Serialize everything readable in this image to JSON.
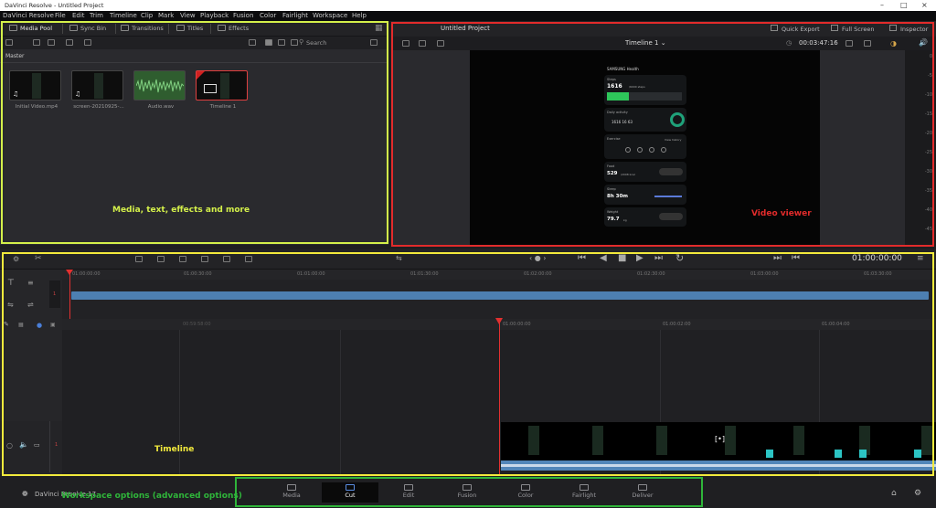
{
  "window": {
    "title": "DaVinci Resolve - Untitled Project"
  },
  "menu": [
    "DaVinci Resolve",
    "File",
    "Edit",
    "Trim",
    "Timeline",
    "Clip",
    "Mark",
    "View",
    "Playback",
    "Fusion",
    "Color",
    "Fairlight",
    "Workspace",
    "Help"
  ],
  "media_pool": {
    "tabs": [
      "Media Pool",
      "Sync Bin",
      "Transitions",
      "Titles",
      "Effects"
    ],
    "search_placeholder": "Search",
    "bin": "Master",
    "clips": [
      "Initial Video.mp4",
      "screen-20210925-...",
      "Audio.wav",
      "Timeline 1"
    ]
  },
  "viewer": {
    "project_title": "Untitled Project",
    "timeline_name": "Timeline 1",
    "timecode": "00:03:47:16",
    "buttons": [
      "Quick Export",
      "Full Screen",
      "Inspector"
    ],
    "meter_scale": [
      "0",
      "-5",
      "-10",
      "-15",
      "-20",
      "-25",
      "-30",
      "-35",
      "-40",
      "-45",
      "-50"
    ]
  },
  "phone": {
    "header": "SAMSUNG Health",
    "cards": [
      {
        "title": "Steps",
        "value": "1616",
        "sub": "/6000 steps"
      },
      {
        "title": "Daily activity",
        "value": "1616  16  63"
      },
      {
        "title": "Exercise",
        "value": "View history"
      },
      {
        "title": "Food",
        "value": "529",
        "sub": "/2008 kcal"
      },
      {
        "title": "Sleep",
        "value": "8h 30m"
      },
      {
        "title": "Weight",
        "value": "79.7",
        "sub": "kg"
      }
    ]
  },
  "timeline": {
    "timecode": "01:00:00:00",
    "ruler_top": [
      "01:00:00:00",
      "01:00:30:00",
      "01:01:00:00",
      "01:01:30:00",
      "01:02:00:00",
      "01:02:30:00",
      "01:03:00:00",
      "01:03:30:00"
    ],
    "ruler_bottom": [
      "00:59:58:00",
      "01:00:00:00",
      "01:00:02:00",
      "01:00:04:00"
    ],
    "track_num": "1"
  },
  "workspace": {
    "app_name": "DaVinci Resolve 17",
    "pages": [
      "Media",
      "Cut",
      "Edit",
      "Fusion",
      "Color",
      "Fairlight",
      "Deliver"
    ],
    "active": "Cut"
  },
  "annotations": {
    "media": "Media, text, effects and more",
    "viewer": "Video viewer",
    "timeline": "Timeline",
    "workspace": "Workspace options (advanced options)"
  },
  "colors": {
    "media_box": "#d4f04a",
    "viewer_box": "#e22b2b",
    "timeline_box": "#f2ea3c",
    "workspace_box": "#2fb53a"
  }
}
